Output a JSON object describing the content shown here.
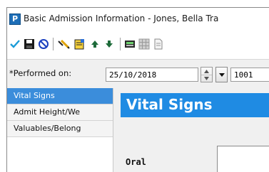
{
  "window": {
    "app_icon_letter": "P",
    "title": "Basic Admission Information - Jones, Bella Tra"
  },
  "toolbar": {
    "items": [
      {
        "icon": "checkmark-icon"
      },
      {
        "icon": "save-icon"
      },
      {
        "icon": "cancel-icon"
      },
      {
        "icon": "comment-icon"
      },
      {
        "icon": "notes-icon"
      },
      {
        "icon": "arrow-up-icon"
      },
      {
        "icon": "arrow-down-icon"
      },
      {
        "icon": "calculator-icon"
      },
      {
        "icon": "grid-icon"
      },
      {
        "icon": "document-icon"
      }
    ]
  },
  "performed": {
    "label": "*Performed on:",
    "date": "25/10/2018",
    "time": "1001"
  },
  "sidebar": {
    "items": [
      {
        "label": "Vital Signs",
        "active": true
      },
      {
        "label": "Admit Height/We",
        "active": false
      },
      {
        "label": "Valuables/Belong",
        "active": false
      }
    ]
  },
  "main": {
    "section_title": "Vital Signs",
    "field_label": "Oral"
  },
  "colors": {
    "accent": "#1f8be3",
    "selected": "#3b8ddb",
    "app_icon": "#1e6fb8"
  }
}
